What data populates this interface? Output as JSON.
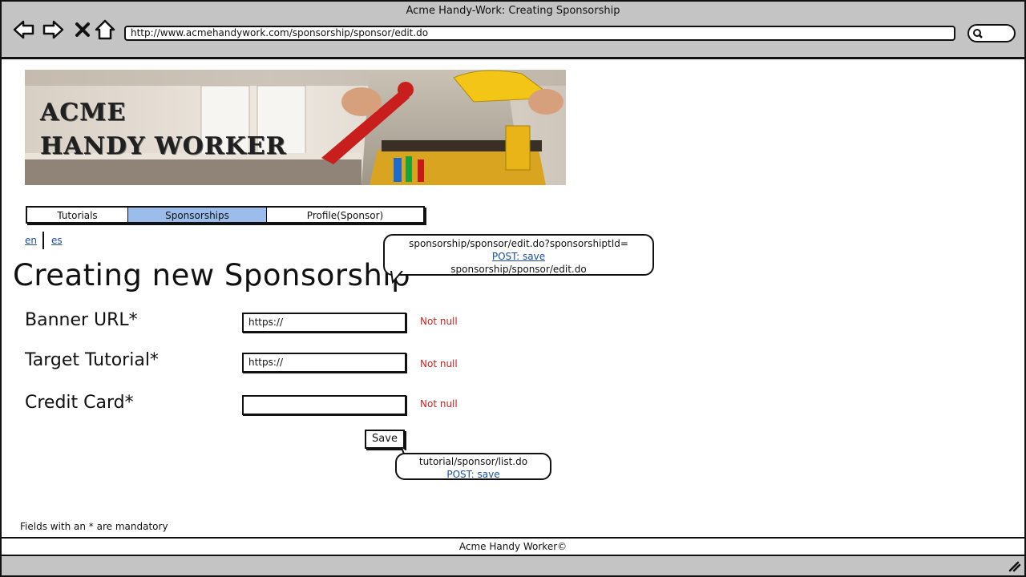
{
  "window": {
    "title": "Acme Handy-Work:  Creating Sponsorship"
  },
  "browser": {
    "url": "http://www.acmehandywork.com/sponsorship/sponsor/edit.do"
  },
  "banner": {
    "line1": "ACME",
    "line2": "HANDY WORKER"
  },
  "tabs": [
    {
      "label": "Tutorials"
    },
    {
      "label": "Sponsorships"
    },
    {
      "label": "Profile(Sponsor)"
    }
  ],
  "lang": {
    "en": "en",
    "es": "es"
  },
  "page": {
    "title": "Creating new Sponsorship"
  },
  "callout_top": {
    "line1": "sponsorship/sponsor/edit.do?sponsorshiptId=",
    "line2": "POST: save",
    "line3": "sponsorship/sponsor/edit.do"
  },
  "form": {
    "fields": [
      {
        "label": "Banner URL*",
        "value": "https://",
        "error": "Not null"
      },
      {
        "label": "Target Tutorial*",
        "value": "https://",
        "error": "Not null"
      },
      {
        "label": "Credit Card*",
        "value": "",
        "error": "Not null"
      }
    ],
    "save_label": "Save"
  },
  "callout_save": {
    "line1": "tutorial/sponsor/list.do",
    "line2": "POST: save"
  },
  "mandatory_note": "Fields with an * are mandatory",
  "footer": {
    "text": "Acme Handy Worker©"
  },
  "colors": {
    "active_tab": "#9cbcec",
    "link": "#1a4da8",
    "error": "#cc1f1f",
    "chrome": "#c4c4c4"
  }
}
